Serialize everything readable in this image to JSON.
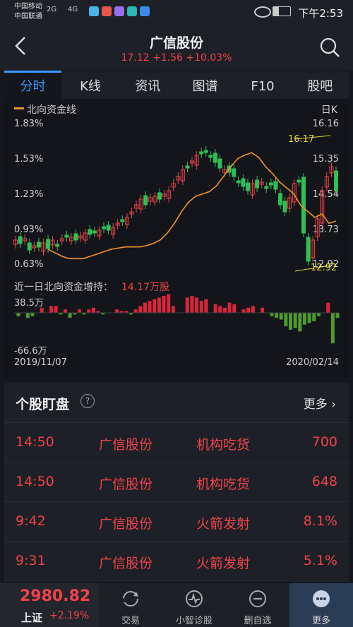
{
  "status": {
    "carrier1": "中国移动",
    "carrier2": "中国联通",
    "net1": "2G",
    "net2": "4G",
    "time": "下午2:53"
  },
  "header": {
    "title": "广信股份",
    "price": "17.12",
    "change": "+1.56",
    "pct": "+10.03%"
  },
  "tabs": [
    "分时",
    "K线",
    "资讯",
    "图谱",
    "F10",
    "股吧"
  ],
  "chart": {
    "legend": "北向资金线",
    "period": "日K",
    "left_axis": [
      "1.83%",
      "1.53%",
      "1.23%",
      "0.93%",
      "0.63%"
    ],
    "right_axis": [
      "16.16",
      "15.35",
      "14.54",
      "13.73",
      "12.92"
    ],
    "high_label": "16.17",
    "low_label": "12.92",
    "flow_title": "近一日北向资金增持：",
    "flow_value": "14.17万股",
    "flow_max": "38.5万",
    "flow_min": "-66.6万",
    "date_start": "2019/11/07",
    "date_end": "2020/02/14"
  },
  "chart_data": {
    "type": "line",
    "series": [
      {
        "name": "北向资金线",
        "values": [
          0.78,
          0.75,
          0.72,
          0.7,
          0.7,
          0.7,
          0.72,
          0.74,
          0.76,
          0.78,
          0.79,
          0.8,
          0.8,
          0.8,
          0.81,
          0.83,
          0.86,
          0.92,
          1.0,
          1.1,
          1.18,
          1.23,
          1.25,
          1.27,
          1.32,
          1.4,
          1.48,
          1.55,
          1.58,
          1.6,
          1.56,
          1.48,
          1.42,
          1.35,
          1.3,
          1.25,
          1.15,
          1.1,
          1.05,
          1.08,
          1.0,
          1.02
        ]
      }
    ],
    "ylim": [
      0.63,
      1.83
    ]
  },
  "watch": {
    "title": "个股盯盘",
    "more": "更多",
    "rows": [
      {
        "time": "14:50",
        "name": "广信股份",
        "event": "机构吃货",
        "value": "700"
      },
      {
        "time": "14:50",
        "name": "广信股份",
        "event": "机构吃货",
        "value": "648"
      },
      {
        "time": "9:42",
        "name": "广信股份",
        "event": "火箭发射",
        "value": "8.1%"
      },
      {
        "time": "9:31",
        "name": "广信股份",
        "event": "火箭发射",
        "value": "5.1%"
      }
    ]
  },
  "bottom": {
    "index_value": "2980.82",
    "index_name": "上证",
    "index_pct": "+2.19%",
    "nav": [
      "交易",
      "小智诊股",
      "删自选",
      "更多"
    ]
  }
}
